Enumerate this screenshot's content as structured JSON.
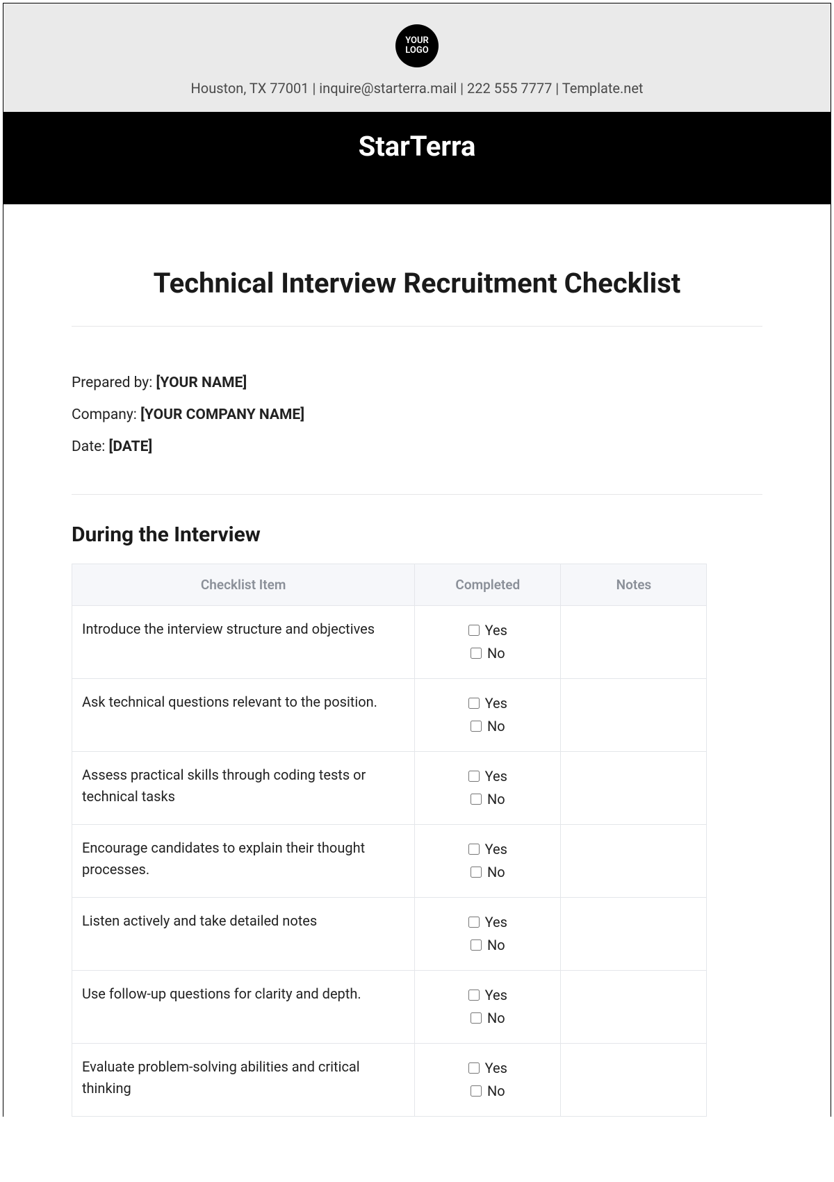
{
  "header": {
    "logo_text": "YOUR LOGO",
    "contact_line": "Houston, TX 77001 | inquire@starterra.mail | 222 555 7777 | Template.net",
    "brand": "StarTerra"
  },
  "document": {
    "title": "Technical Interview Recruitment Checklist",
    "prepared_by_label": "Prepared by: ",
    "prepared_by_value": "[YOUR NAME]",
    "company_label": "Company: ",
    "company_value": "[YOUR COMPANY NAME]",
    "date_label": "Date: ",
    "date_value": "[DATE]"
  },
  "section": {
    "title": "During the Interview",
    "columns": {
      "item": "Checklist Item",
      "completed": "Completed",
      "notes": "Notes"
    },
    "options": {
      "yes": "Yes",
      "no": "No"
    },
    "items": [
      {
        "text": "Introduce the interview structure and objectives"
      },
      {
        "text": "Ask technical questions relevant to the position."
      },
      {
        "text": "Assess practical skills through coding tests or technical tasks"
      },
      {
        "text": "Encourage candidates to explain their thought processes."
      },
      {
        "text": "Listen actively and take detailed notes"
      },
      {
        "text": "Use follow-up questions for clarity and depth."
      },
      {
        "text": "Evaluate problem-solving abilities and critical thinking"
      }
    ]
  }
}
